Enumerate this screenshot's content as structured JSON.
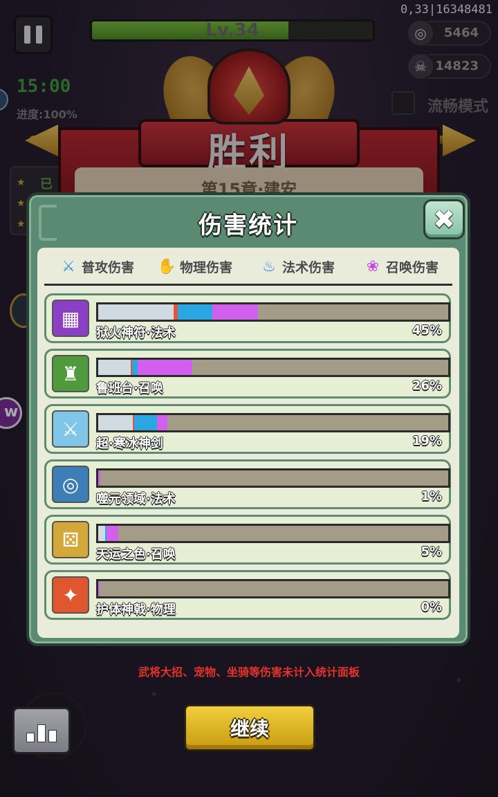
{
  "hud": {
    "level": "Lv.34",
    "level_progress": 0.7,
    "id_text": "0,33|16348481",
    "coins": "5464",
    "skulls": "14823",
    "timer": "15:00",
    "progress": "进度:100%",
    "smooth_mode": "流畅模式"
  },
  "victory": {
    "title": "胜利",
    "chapter": "第15章·建安",
    "side_label": "已"
  },
  "panel": {
    "title": "伤害统计",
    "close": "✖",
    "legend": [
      {
        "label": "普攻伤害",
        "icon": "sword-icon",
        "color": "#3d8fe0"
      },
      {
        "label": "物理伤害",
        "icon": "claw-icon",
        "color": "#e03a3a"
      },
      {
        "label": "法术伤害",
        "icon": "flame-icon",
        "color": "#2f7fe6"
      },
      {
        "label": "召唤伤害",
        "icon": "paw-icon",
        "color": "#c24fe0"
      }
    ],
    "rows": [
      {
        "name": "狱火神符·法术",
        "percent": "45%",
        "icon": "rune-icon",
        "segments": [
          0.215,
          0.012,
          0.1,
          0.13
        ]
      },
      {
        "name": "鲁班台·召唤",
        "percent": "26%",
        "icon": "tower-icon",
        "segments": [
          0.092,
          0.004,
          0.016,
          0.157
        ]
      },
      {
        "name": "超·寒冰神剑",
        "percent": "19%",
        "icon": "ice-sword-icon",
        "segments": [
          0.098,
          0.004,
          0.066,
          0.03
        ]
      },
      {
        "name": "噬元领域·法术",
        "percent": "1%",
        "icon": "vortex-icon",
        "segments": [
          0.0,
          0.0,
          0.0,
          0.006
        ]
      },
      {
        "name": "天运之色·召唤",
        "percent": "5%",
        "icon": "dice-icon",
        "segments": [
          0.02,
          0.0,
          0.004,
          0.034
        ]
      },
      {
        "name": "护体神戟·物理",
        "percent": "0%",
        "icon": "halberd-icon",
        "segments": [
          0.0,
          0.0,
          0.0,
          0.004
        ]
      }
    ]
  },
  "segment_colors": [
    "#cfdbe0",
    "#e2553a",
    "#2aa7e2",
    "#d160ec"
  ],
  "note": "武将大招、宠物、坐骑等伤害未计入统计面板",
  "continue_label": "继续"
}
